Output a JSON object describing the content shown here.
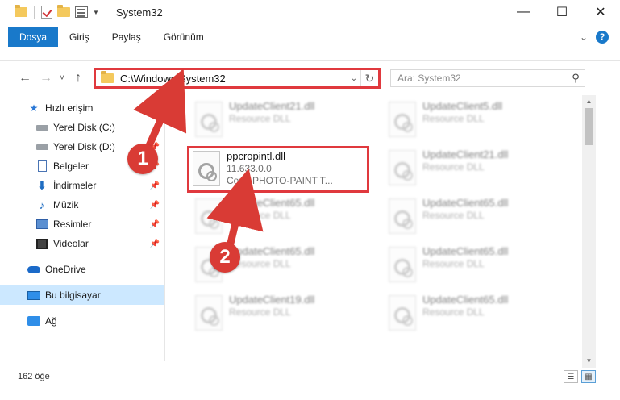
{
  "window": {
    "title": "System32",
    "minimize": "—",
    "maximize": "☐",
    "close": "✕"
  },
  "ribbon": {
    "tabs": [
      "Dosya",
      "Giriş",
      "Paylaş",
      "Görünüm"
    ],
    "help": "?"
  },
  "navigation": {
    "back": "←",
    "forward": "→",
    "recent": "˅",
    "up": "↑",
    "address": "C:\\Windows\\System32",
    "search_placeholder": "Ara: System32"
  },
  "sidebar": {
    "items": [
      {
        "label": "Hızlı erişim",
        "icon": "star-icon",
        "pinned": false
      },
      {
        "label": "Yerel Disk (C:)",
        "icon": "drive-icon",
        "pinned": false
      },
      {
        "label": "Yerel Disk (D:)",
        "icon": "drive-icon",
        "pinned": true
      },
      {
        "label": "Belgeler",
        "icon": "documents-icon",
        "pinned": true
      },
      {
        "label": "İndirmeler",
        "icon": "downloads-icon",
        "pinned": true
      },
      {
        "label": "Müzik",
        "icon": "music-icon",
        "pinned": true
      },
      {
        "label": "Resimler",
        "icon": "pictures-icon",
        "pinned": true
      },
      {
        "label": "Videolar",
        "icon": "videos-icon",
        "pinned": true
      },
      {
        "label": "OneDrive",
        "icon": "onedrive-icon",
        "pinned": false
      },
      {
        "label": "Bu bilgisayar",
        "icon": "this-pc-icon",
        "pinned": false,
        "selected": true
      },
      {
        "label": "Ağ",
        "icon": "network-icon",
        "pinned": false
      }
    ]
  },
  "files": [
    {
      "name": "UpdateClient21.dll",
      "type": "Resource DLL"
    },
    {
      "name": "UpdateClient5.dll",
      "type": "Resource DLL"
    },
    {
      "name": "UpdateClient21.dll",
      "type": "Resource DLL"
    },
    {
      "name": "UpdateClient65.dll",
      "type": "Resource DLL"
    },
    {
      "name": "UpdateClient65.dll",
      "type": "Resource DLL"
    },
    {
      "name": "UpdateClient65.dll",
      "type": "Resource DLL"
    },
    {
      "name": "UpdateClient65.dll",
      "type": "Resource DLL"
    },
    {
      "name": "UpdateClient19.dll",
      "type": "Resource DLL"
    },
    {
      "name": "UpdateClient65.dll",
      "type": "Resource DLL"
    }
  ],
  "highlighted_file": {
    "name": "ppcropintl.dll",
    "version": "11.633.0.0",
    "description": "Corel PHOTO-PAINT T..."
  },
  "status": {
    "item_count": "162 öğe"
  },
  "annotations": {
    "step1": "1",
    "step2": "2",
    "color": "#d93b35"
  }
}
